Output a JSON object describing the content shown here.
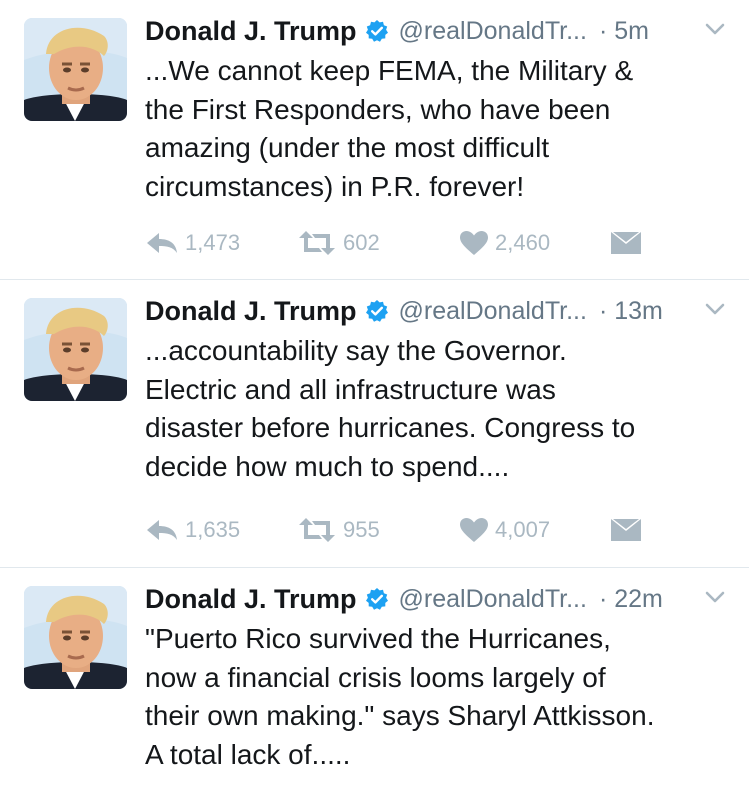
{
  "tweets": [
    {
      "author_name": "Donald J. Trump",
      "handle": "@realDonaldTr...",
      "time": "· 5m",
      "text": "...We cannot keep FEMA, the Military &\nthe First Responders, who have been\namazing (under the most difficult\ncircumstances) in P.R. forever!",
      "replies": "1,473",
      "retweets": "602",
      "likes": "2,460"
    },
    {
      "author_name": "Donald J. Trump",
      "handle": "@realDonaldTr...",
      "time": "· 13m",
      "text": "...accountability say the Governor.\nElectric and all infrastructure was\ndisaster before hurricanes. Congress to\ndecide how much to spend....",
      "replies": "1,635",
      "retweets": "955",
      "likes": "4,007"
    },
    {
      "author_name": "Donald J. Trump",
      "handle": "@realDonaldTr...",
      "time": "· 22m",
      "text": "\"Puerto Rico survived the Hurricanes,\nnow a financial crisis looms largely of\ntheir own making.\" says Sharyl Attkisson.\nA total lack of.....",
      "replies": "",
      "retweets": "",
      "likes": ""
    }
  ],
  "colors": {
    "text": "#14171a",
    "secondary": "#657786",
    "action_icon": "#aab8c2",
    "verified": "#1da1f2",
    "divider": "#e1e8ed"
  },
  "icons": {
    "reply": "reply-icon",
    "retweet": "retweet-icon",
    "like": "heart-icon",
    "dm": "envelope-icon",
    "verified": "verified-badge-icon",
    "menu": "chevron-down-icon"
  }
}
